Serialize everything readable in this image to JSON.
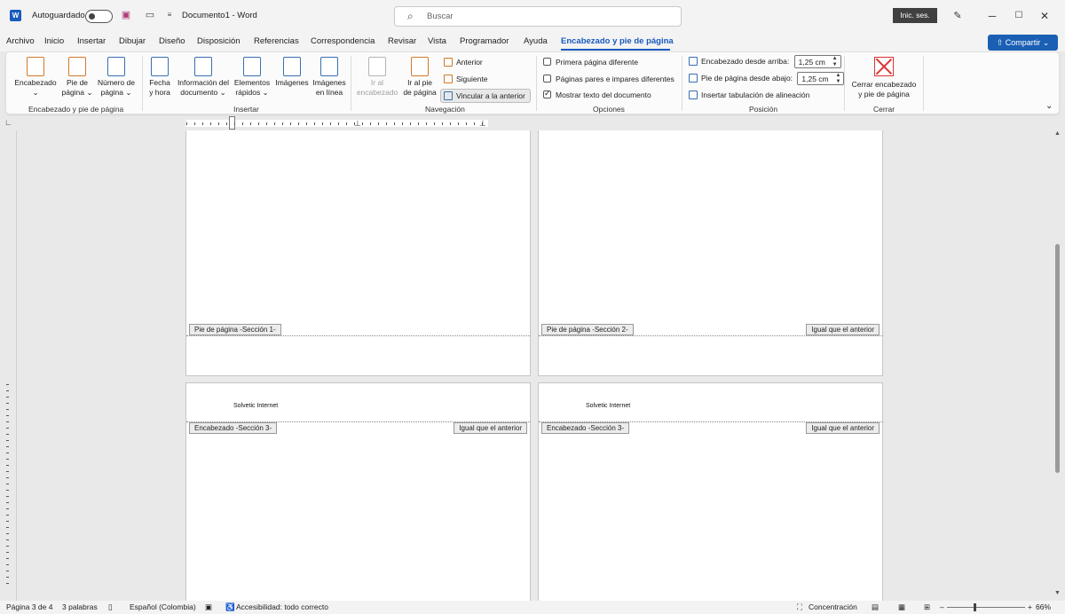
{
  "titlebar": {
    "autosave": "Autoguardado",
    "doc_title": "Documento1  -  Word",
    "search_placeholder": "Buscar",
    "signin": "Inic. ses."
  },
  "tabs": [
    "Archivo",
    "Inicio",
    "Insertar",
    "Dibujar",
    "Diseño",
    "Disposición",
    "Referencias",
    "Correspondencia",
    "Revisar",
    "Vista",
    "Programador",
    "Ayuda",
    "Encabezado y pie de página"
  ],
  "share": "Compartir",
  "ribbon": {
    "encabezado_group": {
      "header": [
        "Encabezado",
        "⌄"
      ],
      "footer": [
        "Pie de",
        "página ⌄"
      ],
      "page_number": [
        "Número de",
        "página ⌄"
      ],
      "label": "Encabezado y pie de página"
    },
    "insertar_group": {
      "datetime": [
        "Fecha",
        "y hora"
      ],
      "docinfo": [
        "Información del",
        "documento ⌄"
      ],
      "quickparts": [
        "Elementos",
        "rápidos ⌄"
      ],
      "images": [
        "Imágenes"
      ],
      "online_images": [
        "Imágenes",
        "en línea"
      ],
      "label": "Insertar"
    },
    "navegacion_group": {
      "goto_header": [
        "Ir al",
        "encabezado"
      ],
      "goto_footer": [
        "Ir al pie",
        "de página"
      ],
      "previous": "Anterior",
      "next": "Siguiente",
      "link_previous": "Vincular a la anterior",
      "label": "Navegación"
    },
    "opciones_group": {
      "different_first": "Primera página diferente",
      "odd_even": "Páginas pares e impares diferentes",
      "show_text": "Mostrar texto del documento",
      "label": "Opciones"
    },
    "posicion_group": {
      "header_top_label": "Encabezado desde arriba:",
      "header_top_value": "1,25 cm",
      "footer_bottom_label": "Pie de página desde abajo:",
      "footer_bottom_value": "1,25 cm",
      "align_tab": "Insertar tabulación de alineación",
      "label": "Posición"
    },
    "cerrar_group": {
      "close": [
        "Cerrar encabezado",
        "y pie de página"
      ],
      "label": "Cerrar"
    }
  },
  "pages": {
    "footer1_tag": "Pie de página -Sección 1-",
    "footer2_tag": "Pie de página -Sección 2-",
    "same_as_previous": "Igual que el anterior",
    "header3_tag": "Encabezado -Sección 3-",
    "header_text": "Solvetic Internet"
  },
  "status": {
    "page": "Página 3 de 4",
    "words": "3 palabras",
    "language": "Español (Colombia)",
    "accessibility": "Accesibilidad: todo correcto",
    "focus": "Concentración",
    "zoom": "66%"
  }
}
